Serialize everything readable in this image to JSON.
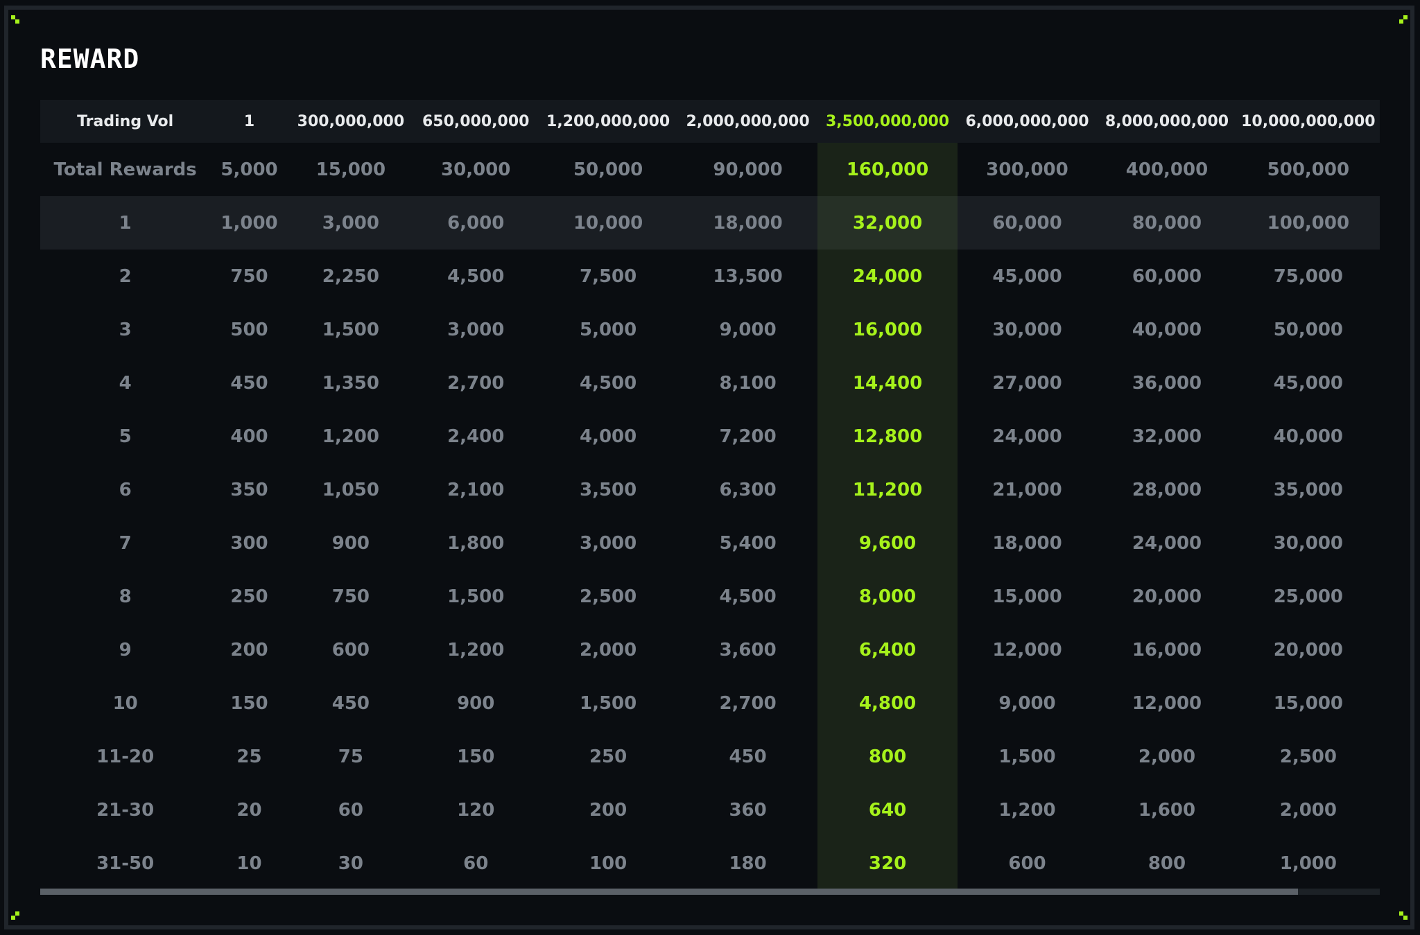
{
  "title": "REWARD",
  "colors": {
    "accent": "#a6f21b",
    "background": "#0a0d11",
    "header_bg": "#14181d",
    "text_muted": "#7c838c"
  },
  "table": {
    "columns": [
      "Trading Vol",
      "1",
      "300,000,000",
      "650,000,000",
      "1,200,000,000",
      "2,000,000,000",
      "3,500,000,000",
      "6,000,000,000",
      "8,000,000,000",
      "10,000,000,000"
    ],
    "highlighted_column_index": 6,
    "highlighted_row_index": 1,
    "rows": [
      [
        "Total Rewards",
        "5,000",
        "15,000",
        "30,000",
        "50,000",
        "90,000",
        "160,000",
        "300,000",
        "400,000",
        "500,000"
      ],
      [
        "1",
        "1,000",
        "3,000",
        "6,000",
        "10,000",
        "18,000",
        "32,000",
        "60,000",
        "80,000",
        "100,000"
      ],
      [
        "2",
        "750",
        "2,250",
        "4,500",
        "7,500",
        "13,500",
        "24,000",
        "45,000",
        "60,000",
        "75,000"
      ],
      [
        "3",
        "500",
        "1,500",
        "3,000",
        "5,000",
        "9,000",
        "16,000",
        "30,000",
        "40,000",
        "50,000"
      ],
      [
        "4",
        "450",
        "1,350",
        "2,700",
        "4,500",
        "8,100",
        "14,400",
        "27,000",
        "36,000",
        "45,000"
      ],
      [
        "5",
        "400",
        "1,200",
        "2,400",
        "4,000",
        "7,200",
        "12,800",
        "24,000",
        "32,000",
        "40,000"
      ],
      [
        "6",
        "350",
        "1,050",
        "2,100",
        "3,500",
        "6,300",
        "11,200",
        "21,000",
        "28,000",
        "35,000"
      ],
      [
        "7",
        "300",
        "900",
        "1,800",
        "3,000",
        "5,400",
        "9,600",
        "18,000",
        "24,000",
        "30,000"
      ],
      [
        "8",
        "250",
        "750",
        "1,500",
        "2,500",
        "4,500",
        "8,000",
        "15,000",
        "20,000",
        "25,000"
      ],
      [
        "9",
        "200",
        "600",
        "1,200",
        "2,000",
        "3,600",
        "6,400",
        "12,000",
        "16,000",
        "20,000"
      ],
      [
        "10",
        "150",
        "450",
        "900",
        "1,500",
        "2,700",
        "4,800",
        "9,000",
        "12,000",
        "15,000"
      ],
      [
        "11-20",
        "25",
        "75",
        "150",
        "250",
        "450",
        "800",
        "1,500",
        "2,000",
        "2,500"
      ],
      [
        "21-30",
        "20",
        "60",
        "120",
        "200",
        "360",
        "640",
        "1,200",
        "1,600",
        "2,000"
      ],
      [
        "31-50",
        "10",
        "30",
        "60",
        "100",
        "180",
        "320",
        "600",
        "800",
        "1,000"
      ]
    ]
  },
  "scrollbar": {
    "position_fraction": 0.94
  }
}
